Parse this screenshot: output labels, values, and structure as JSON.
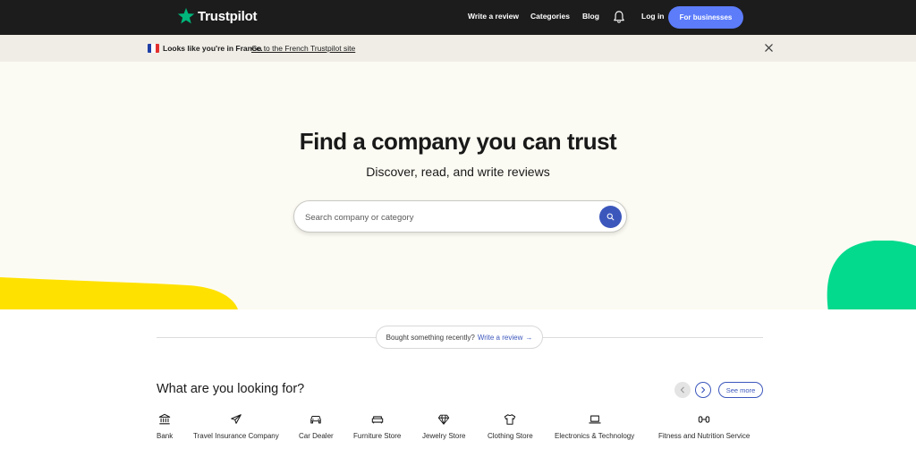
{
  "header": {
    "logo_text": "Trustpilot",
    "nav": {
      "write_review": "Write a review",
      "categories": "Categories",
      "blog": "Blog",
      "login": "Log in",
      "for_businesses": "For businesses"
    }
  },
  "banner": {
    "message": "Looks like you're in France.",
    "link": "Go to the French Trustpilot site"
  },
  "hero": {
    "title": "Find a company you can trust",
    "subtitle": "Discover, read, and write reviews",
    "search_placeholder": "Search company or category"
  },
  "recent": {
    "text": "Bought something recently?",
    "link": "Write a review",
    "arrow": "→"
  },
  "categories": {
    "title": "What are you looking for?",
    "see_more": "See more",
    "items": [
      {
        "label": "Bank",
        "icon": "bank-icon"
      },
      {
        "label": "Travel Insurance Company",
        "icon": "airplane-icon"
      },
      {
        "label": "Car Dealer",
        "icon": "car-icon"
      },
      {
        "label": "Furniture Store",
        "icon": "sofa-icon"
      },
      {
        "label": "Jewelry Store",
        "icon": "diamond-icon"
      },
      {
        "label": "Clothing Store",
        "icon": "tshirt-icon"
      },
      {
        "label": "Electronics & Technology",
        "icon": "laptop-icon"
      },
      {
        "label": "Fitness and Nutrition Service",
        "icon": "dumbbell-icon"
      }
    ]
  },
  "colors": {
    "nav_bg": "#1c1c1c",
    "brand_green": "#00b67a",
    "accent_blue": "#5c7cfa",
    "search_button": "#3c57bc",
    "hero_bg": "#fcfbf3",
    "banner_bg": "#f0ede6",
    "blob_yellow": "#ffe100",
    "blob_green": "#04da8d"
  }
}
